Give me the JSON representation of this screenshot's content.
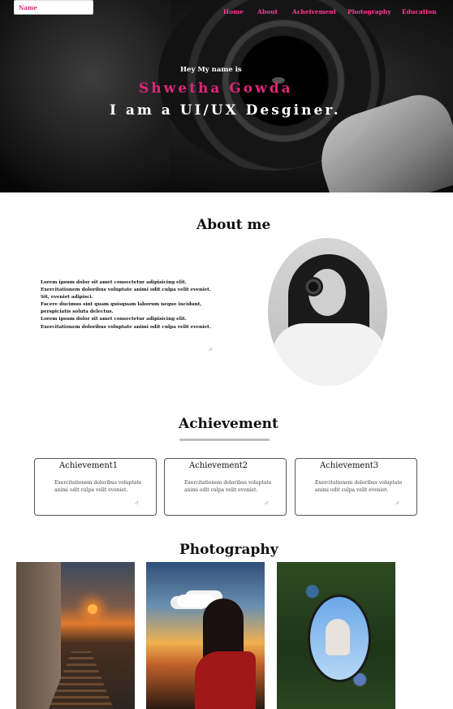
{
  "header": {
    "name_input_placeholder": "Name",
    "nav": [
      "Home",
      "About",
      "Acheivement",
      "Photography",
      "Education"
    ],
    "accent_color": "#e0247b"
  },
  "hero": {
    "greeting": "Hey  My name is",
    "name": "Shwetha Gowda",
    "role": "I am a UI/UX Desginer."
  },
  "about": {
    "title": "About me",
    "text": "Lorem ipsum dolor sit amet consectetur adipisicing elit.\n Exercitationem doloribus voluptate animi odit culpa velit eveniet.\nSit, eveniet adipisci.\n Facere ducimus sint quam quisquam laborum neque incidunt,\nperspiciatis soluta delectus.\n Lorem ipsum dolor sit amet consectetur adipisicing elit.\n Exercitationem doloribus voluptate animi odit culpa velit eveniet.",
    "resize_glyph": "◿"
  },
  "achievement": {
    "title": "Achievement",
    "cards": [
      {
        "title": "Achievement1",
        "text": "Exercitationem doloribus voluptate animi odit culpa velit eveniet."
      },
      {
        "title": "Achievement2",
        "text": "Exercitationem doloribus voluptate animi odit culpa velit eveniet."
      },
      {
        "title": "Achievement3",
        "text": "Exercitationem doloribus voluptate animi odit culpa velit eveniet."
      }
    ]
  },
  "photography": {
    "title": "Photography"
  }
}
